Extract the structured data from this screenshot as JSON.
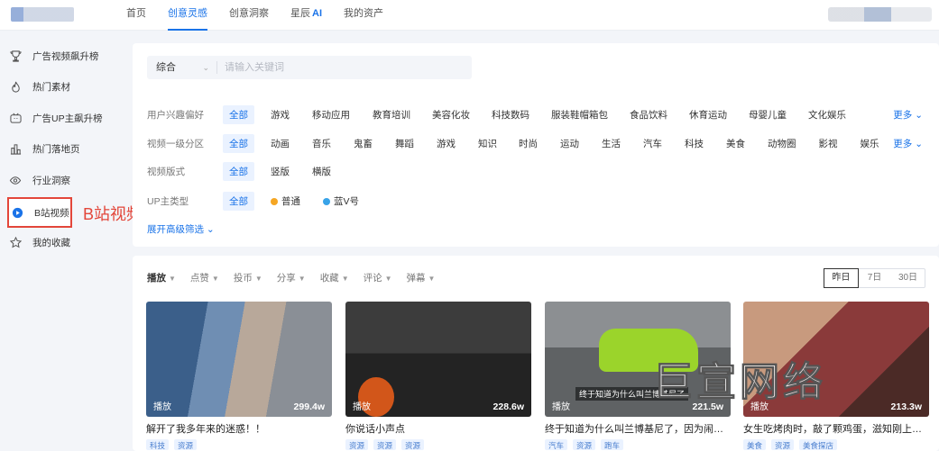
{
  "topnav": {
    "items": [
      {
        "label": "首页"
      },
      {
        "label": "创意灵感"
      },
      {
        "label": "创意洞察"
      },
      {
        "label": "星辰",
        "suffix": "AI"
      },
      {
        "label": "我的资产"
      }
    ],
    "active_index": 1
  },
  "sidebar": {
    "items": [
      {
        "label": "广告视频飙升榜",
        "icon": "trophy-icon"
      },
      {
        "label": "热门素材",
        "icon": "flame-icon"
      },
      {
        "label": "广告UP主飙升榜",
        "icon": "tv-icon"
      },
      {
        "label": "热门落地页",
        "icon": "bar-chart-icon"
      },
      {
        "label": "行业洞察",
        "icon": "eye-icon"
      },
      {
        "label": "B站视频",
        "icon": "play-circle-icon"
      },
      {
        "label": "我的收藏",
        "icon": "star-icon"
      }
    ],
    "active_index": 5,
    "callout": "B站视频"
  },
  "search": {
    "select_value": "综合",
    "placeholder": "请输入关键词"
  },
  "filters": {
    "rows": [
      {
        "label": "用户兴趣偏好",
        "options": [
          "全部",
          "游戏",
          "移动应用",
          "教育培训",
          "美容化妆",
          "科技数码",
          "服装鞋帽箱包",
          "食品饮料",
          "休育运动",
          "母婴儿童",
          "文化娱乐"
        ],
        "more": "更多"
      },
      {
        "label": "视频一级分区",
        "options": [
          "全部",
          "动画",
          "音乐",
          "鬼畜",
          "舞蹈",
          "游戏",
          "知识",
          "时尚",
          "运动",
          "生活",
          "汽车",
          "科技",
          "美食",
          "动物圈",
          "影视",
          "娱乐"
        ],
        "more": "更多"
      },
      {
        "label": "视频版式",
        "options": [
          "全部",
          "竖版",
          "横版"
        ]
      },
      {
        "label": "UP主类型",
        "options": [
          "全部",
          "普通",
          "蓝V号"
        ]
      }
    ],
    "advanced": "展开高级筛选"
  },
  "sorts": [
    "播放",
    "点赞",
    "投币",
    "分享",
    "收藏",
    "评论",
    "弹幕"
  ],
  "period": {
    "options": [
      "昨日",
      "7日",
      "30日"
    ],
    "active_index": 0
  },
  "cards": [
    {
      "play_label": "播放",
      "plays": "299.4w",
      "title": "解开了我多年来的迷惑！！",
      "tags": [
        "科技",
        "资源"
      ]
    },
    {
      "play_label": "播放",
      "plays": "228.6w",
      "title": "你说话小声点",
      "tags": [
        "资源",
        "资源",
        "资源"
      ]
    },
    {
      "play_label": "播放",
      "plays": "221.5w",
      "caption": "终于知道为什么叫兰博基尼了",
      "title": "终于知道为什么叫兰博基尼了，因为闹呀就...",
      "tags": [
        "汽车",
        "资源",
        "跑车"
      ]
    },
    {
      "play_label": "播放",
      "plays": "213.3w",
      "title": "女生吃烤肉时，敲了颗鸡蛋，滋知刚上烤盘...",
      "tags": [
        "美食",
        "资源",
        "美食探店"
      ]
    }
  ],
  "watermark": "巨宣网络"
}
